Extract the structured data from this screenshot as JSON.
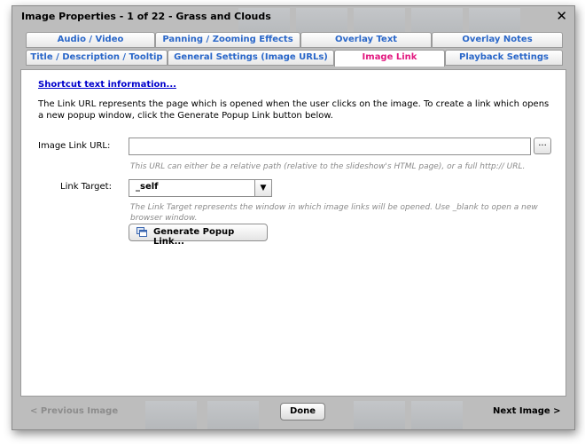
{
  "window": {
    "title": "Image Properties - 1 of 22 - Grass and Clouds",
    "close_glyph": "✕"
  },
  "tabs_row1": [
    {
      "label": "Audio / Video"
    },
    {
      "label": "Panning / Zooming Effects"
    },
    {
      "label": "Overlay Text"
    },
    {
      "label": "Overlay Notes"
    }
  ],
  "tabs_row2": [
    {
      "label": "Title / Description / Tooltip"
    },
    {
      "label": "General Settings (Image URLs)"
    },
    {
      "label": "Image Link",
      "active": true
    },
    {
      "label": "Playback Settings"
    }
  ],
  "panel": {
    "shortcut_link": "Shortcut text information...",
    "description": "The Link URL represents the page which is opened when the user clicks on the image.  To create a link which opens a new popup window, click the Generate Popup Link button below.",
    "url_label": "Image Link URL:",
    "url_value": "",
    "browse_label": "...",
    "url_hint": "This URL can either be a relative path (relative to the slideshow's HTML page), or a full http:// URL.",
    "target_label": "Link Target:",
    "target_value": "_self",
    "target_hint": "The Link Target represents the window in which image links will be opened.  Use _blank to open a new browser window.",
    "popup_button": "Generate Popup Link..."
  },
  "footer": {
    "prev": "< Previous Image",
    "done": "Done",
    "next": "Next Image >"
  },
  "icons": {
    "dropdown": "chevron-down-icon",
    "popup": "popup-window-icon",
    "close": "close-icon"
  }
}
